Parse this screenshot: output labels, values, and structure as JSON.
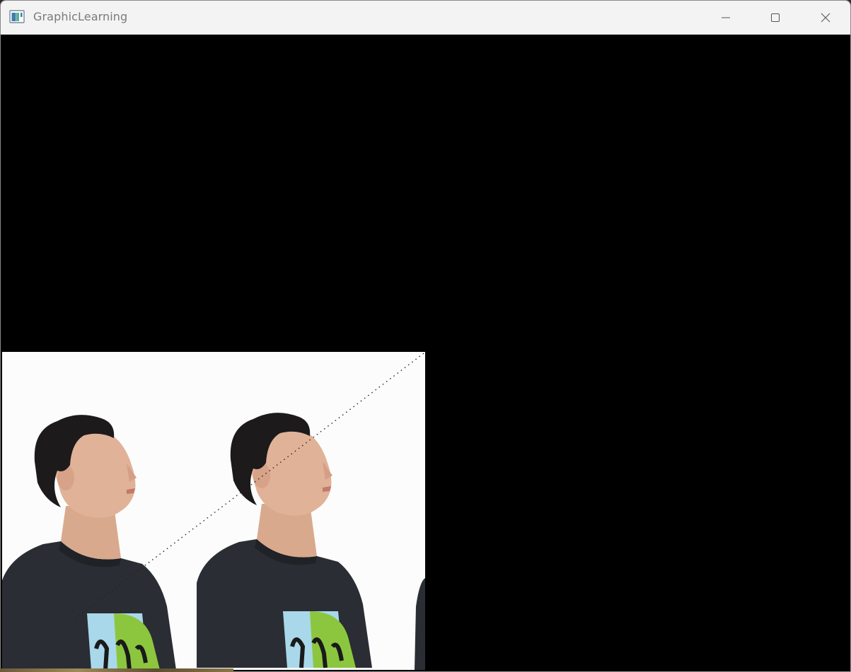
{
  "window": {
    "title": "GraphicLearning",
    "app_icon": "opengl-app-icon"
  },
  "titlebar": {
    "buttons": [
      {
        "name": "minimize",
        "icon": "minimize-icon"
      },
      {
        "name": "maximize",
        "icon": "maximize-icon"
      },
      {
        "name": "close",
        "icon": "close-icon"
      }
    ]
  },
  "viewport": {
    "clear_color": "#000000",
    "quad": {
      "texture": "repeated-portrait-person-looking-up",
      "repeat_count_visible": 2.1,
      "background": "#fcfcfc",
      "has_diagonal_wireframe_edge": true
    }
  },
  "colors": {
    "titlebar_bg": "#f3f3f3",
    "title_text": "#7a7a7a",
    "shirt": "#2a2d33",
    "skin": "#e0b298",
    "hair": "#1c1a1a",
    "print_blue": "#a9d8ea",
    "print_green": "#8cc63f"
  }
}
